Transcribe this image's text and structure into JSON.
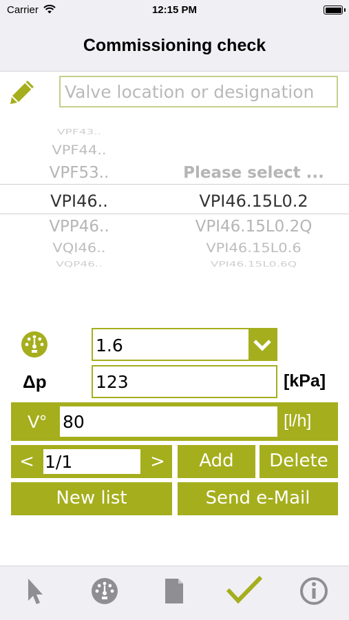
{
  "status_bar": {
    "carrier": "Carrier",
    "time": "12:15 PM"
  },
  "nav": {
    "title": "Commissioning check"
  },
  "location": {
    "placeholder": "Valve location or designation",
    "value": ""
  },
  "picker": {
    "column1": [
      "VPF43..",
      "VPF44..",
      "VPF53..",
      "VPI46..",
      "VPP46..",
      "VQI46..",
      "VQP46.."
    ],
    "column2": [
      "",
      "",
      "Please select ...",
      "VPI46.15L0.2",
      "VPI46.15L0.2Q",
      "VPI46.15L0.6",
      "VPI46.15L0.6Q"
    ],
    "selected_index": 3
  },
  "kvs": {
    "value": "1.6"
  },
  "dp": {
    "label": "Δp",
    "value": "123",
    "unit": "[kPa]"
  },
  "flow": {
    "label": "V°",
    "value": "80",
    "unit": "[l/h]"
  },
  "pager": {
    "prev": "<",
    "value": "1/1",
    "next": ">"
  },
  "buttons": {
    "add": "Add",
    "delete": "Delete",
    "new_list": "New list",
    "send_email": "Send e-Mail"
  },
  "tabbar": {
    "tabs": [
      "pointer-icon",
      "gauge-icon",
      "document-icon",
      "check-icon",
      "info-icon"
    ],
    "active_index": 3
  },
  "colors": {
    "accent": "#a5ae1c",
    "accent_light": "#c6cf8a",
    "bar_bg": "#efeff4",
    "inactive_icon": "#8e8e93"
  }
}
